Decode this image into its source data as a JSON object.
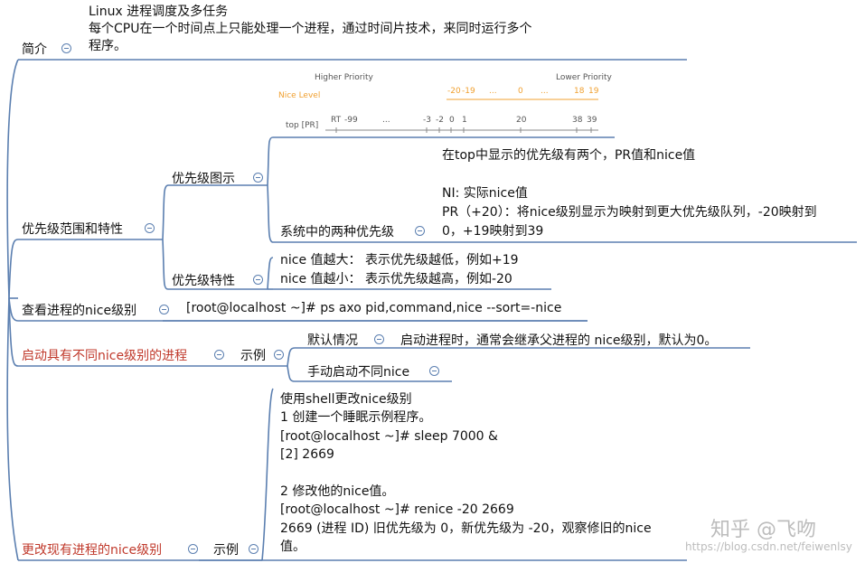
{
  "topics": {
    "intro": {
      "label": "简介",
      "lines": [
        "Linux 进程调度及多任务",
        "每个CPU在一个时间点上只能处理一个进程，通过时间片技术，来同时运行多个",
        "程序。"
      ]
    },
    "priority": {
      "label": "优先级范围和特性",
      "diagram": {
        "label": "优先级图示",
        "figure": {
          "higher": "Higher Priority",
          "lower": "Lower Priority",
          "nice_level_label": "Nice Level",
          "nice_ticks": [
            "-20",
            "-19",
            "...",
            "0",
            "...",
            "18",
            "19"
          ],
          "top_label": "top [PR]",
          "top_ticks": [
            "RT",
            "-99",
            "...",
            "-3",
            "-2",
            "0",
            "1",
            "20",
            "38",
            "39"
          ]
        },
        "two_kinds": {
          "label": "系统中的两种优先级",
          "lines": [
            "在top中显示的优先级有两个，PR值和nice值",
            "",
            "NI: 实际nice值",
            "PR（+20）：将nice级别显示为映射到更大优先级队列，-20映射到",
            "0，+19映射到39"
          ]
        }
      },
      "traits": {
        "label": "优先级特性",
        "lines": [
          "nice 值越大：  表示优先级越低，例如+19",
          "nice 值越小：  表示优先级越高，例如-20"
        ]
      }
    },
    "view": {
      "label": "查看进程的nice级别",
      "command": "[root@localhost ~]# ps axo pid,command,nice --sort=-nice"
    },
    "start": {
      "label": "启动具有不同nice级别的进程",
      "example": "示例",
      "default": {
        "label": "默认情况",
        "text": "启动进程时，通常会继承父进程的 nice级别，默认为0。"
      },
      "manual": {
        "label": "手动启动不同nice"
      }
    },
    "change": {
      "label": "更改现有进程的nice级别",
      "example": "示例",
      "lines": [
        "使用shell更改nice级别",
        "1  创建一个睡眠示例程序。",
        "[root@localhost ~]# sleep 7000 &",
        "[2] 2669",
        "",
        "2  修改他的nice值。",
        "[root@localhost ~]# renice -20 2669",
        "2669 (进程 ID) 旧优先级为 0，新优先级为 -20，观察修旧的nice",
        "值。"
      ]
    }
  },
  "watermark": {
    "brand": "知乎 @飞吻",
    "url": "https://blog.csdn.net/feiwenlsy"
  },
  "colors": {
    "line": "#5b7fb0",
    "red_text": "#c0392b",
    "orange": "#f0a030"
  }
}
